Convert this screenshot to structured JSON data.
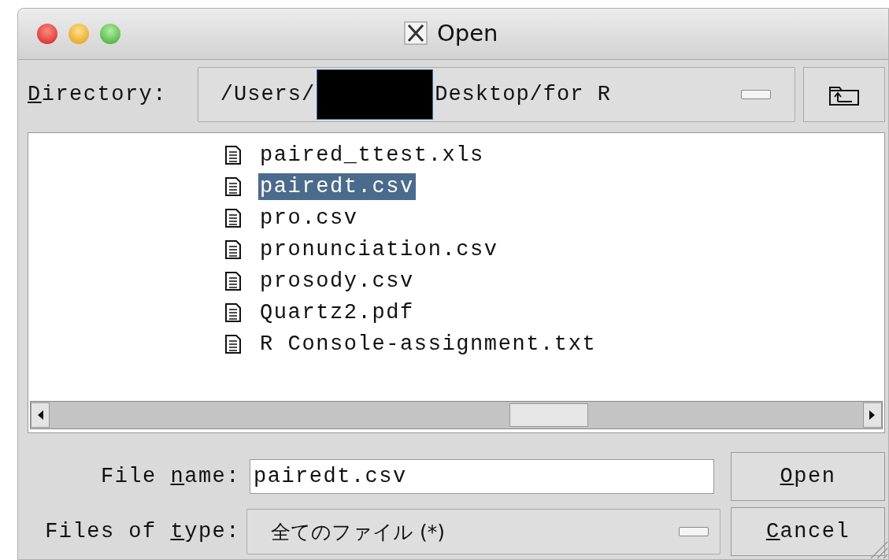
{
  "window": {
    "title": "Open"
  },
  "directory": {
    "label": {
      "key": "D",
      "after": "irectory:"
    },
    "path_before": "/Users/",
    "redacted": true,
    "path_after": "Desktop/for R"
  },
  "files": [
    {
      "name": "paired_ttest.xls",
      "selected": false
    },
    {
      "name": "pairedt.csv",
      "selected": true
    },
    {
      "name": "pro.csv",
      "selected": false
    },
    {
      "name": "pronunciation.csv",
      "selected": false
    },
    {
      "name": "prosody.csv",
      "selected": false
    },
    {
      "name": "Quartz2.pdf",
      "selected": false
    },
    {
      "name": "R Console-assignment.txt",
      "selected": false
    }
  ],
  "file_name": {
    "label": {
      "before": "File ",
      "key": "n",
      "after": "ame:"
    },
    "value": "pairedt.csv"
  },
  "file_type": {
    "label": {
      "before": "Files of ",
      "key": "t",
      "after": "ype:"
    },
    "value": "全てのファイル (*)"
  },
  "buttons": [
    {
      "key": "O",
      "after": "pen"
    },
    {
      "key": "C",
      "after": "ancel"
    }
  ]
}
